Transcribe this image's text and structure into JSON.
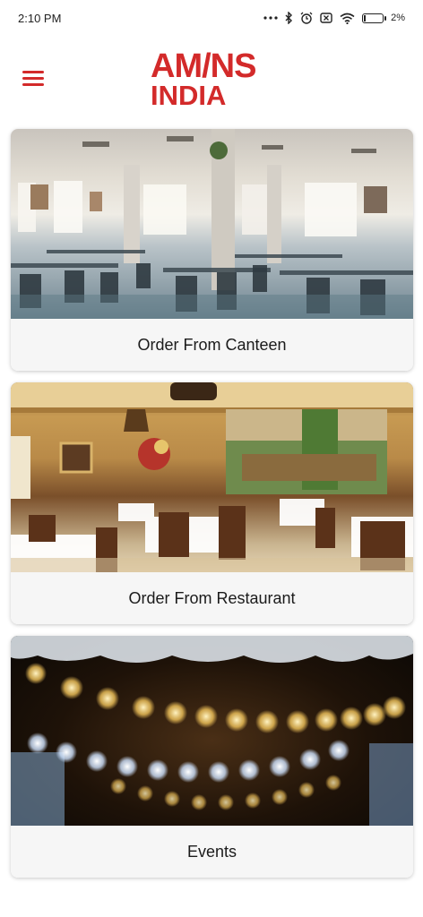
{
  "status_bar": {
    "time": "2:10 PM",
    "battery_percent": "2%",
    "icons": [
      "more-icon",
      "bluetooth-icon",
      "alarm-icon",
      "sim-icon",
      "wifi-icon",
      "battery-icon"
    ]
  },
  "header": {
    "menu_icon": "hamburger-menu-icon",
    "logo_line1": "AM/NS",
    "logo_line2": "INDIA",
    "brand_color": "#d32a2a"
  },
  "cards": [
    {
      "label": "Order From Canteen",
      "image": "canteen-photo"
    },
    {
      "label": "Order From Restaurant",
      "image": "restaurant-photo"
    },
    {
      "label": "Events",
      "image": "events-lights-photo"
    }
  ]
}
